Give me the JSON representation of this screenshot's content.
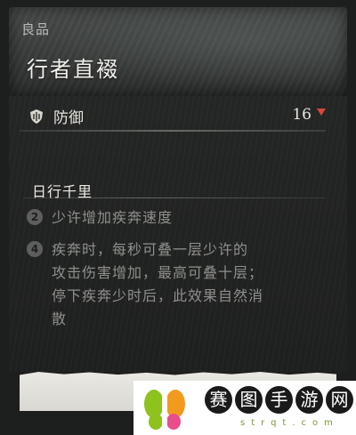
{
  "item": {
    "quality": "良品",
    "name": "行者直裰"
  },
  "stat": {
    "icon": "shield-icon",
    "label": "防御",
    "value": "16",
    "trend": "down",
    "trend_color": "#d9473a"
  },
  "set_bonus": {
    "title": "日行千里",
    "effects": [
      {
        "count": "2",
        "text": "少许增加疾奔速度"
      },
      {
        "count": "4",
        "text": "疾奔时，每秒可叠一层少许的\n攻击伤害增加，最高可叠十层；\n停下疾奔少时后，此效果自然消\n散"
      }
    ]
  },
  "watermark": {
    "title_chars": [
      "赛",
      "图",
      "手",
      "游",
      "网"
    ],
    "subtitle": "strqt.com",
    "logo_colors": [
      "#8dc21f",
      "#f29a1e",
      "#e94d8b"
    ]
  }
}
